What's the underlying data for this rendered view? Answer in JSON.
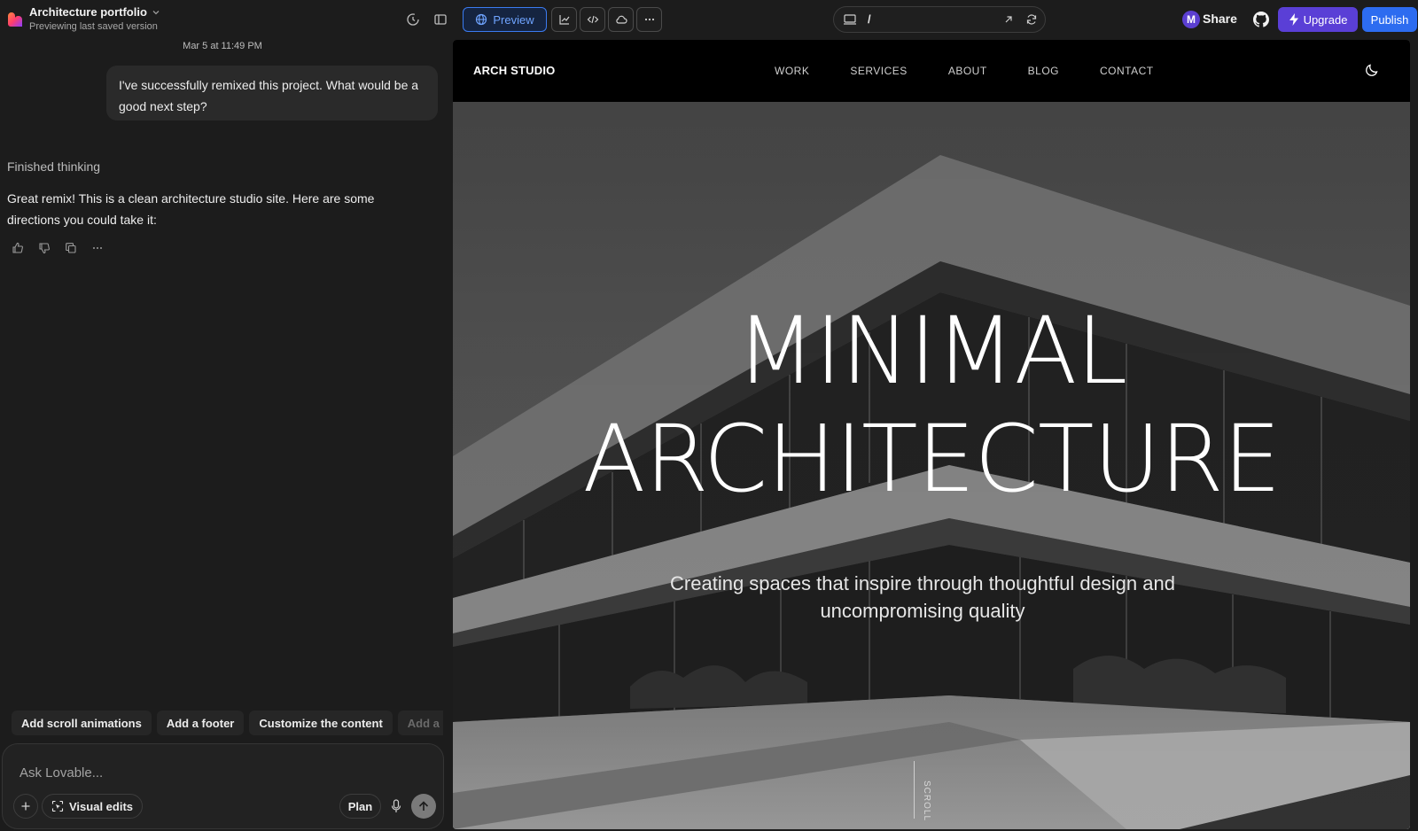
{
  "app": {
    "project_title": "Architecture portfolio",
    "project_subtitle": "Previewing last saved version",
    "preview_label": "Preview",
    "url_path": "/",
    "avatar_initial": "M",
    "share_label": "Share",
    "upgrade_label": "Upgrade",
    "publish_label": "Publish",
    "colors": {
      "accent_blue": "#2d6cf0",
      "upgrade_purple": "#5a3fd6",
      "avatar_purple": "#5b3fd1"
    }
  },
  "chat": {
    "timestamp": "Mar 5 at 11:49 PM",
    "user_message": "I've successfully remixed this project. What would be a good next step?",
    "thinking_status": "Finished thinking",
    "assistant_message": "Great remix! This is a clean architecture studio site. Here are some directions you could take it:",
    "suggestions": [
      "Add scroll animations",
      "Add a footer",
      "Customize the content",
      "Add a co"
    ],
    "composer_placeholder": "Ask Lovable...",
    "visual_edits_label": "Visual edits",
    "plan_label": "Plan"
  },
  "site": {
    "brand": "ARCH STUDIO",
    "nav": [
      "WORK",
      "SERVICES",
      "ABOUT",
      "BLOG",
      "CONTACT"
    ],
    "hero_title_line1": "MINIMAL",
    "hero_title_line2": "ARCHITECTURE",
    "hero_subtitle": "Creating spaces that inspire through thoughtful design and uncompromising quality",
    "scroll_label": "SCROLL"
  }
}
